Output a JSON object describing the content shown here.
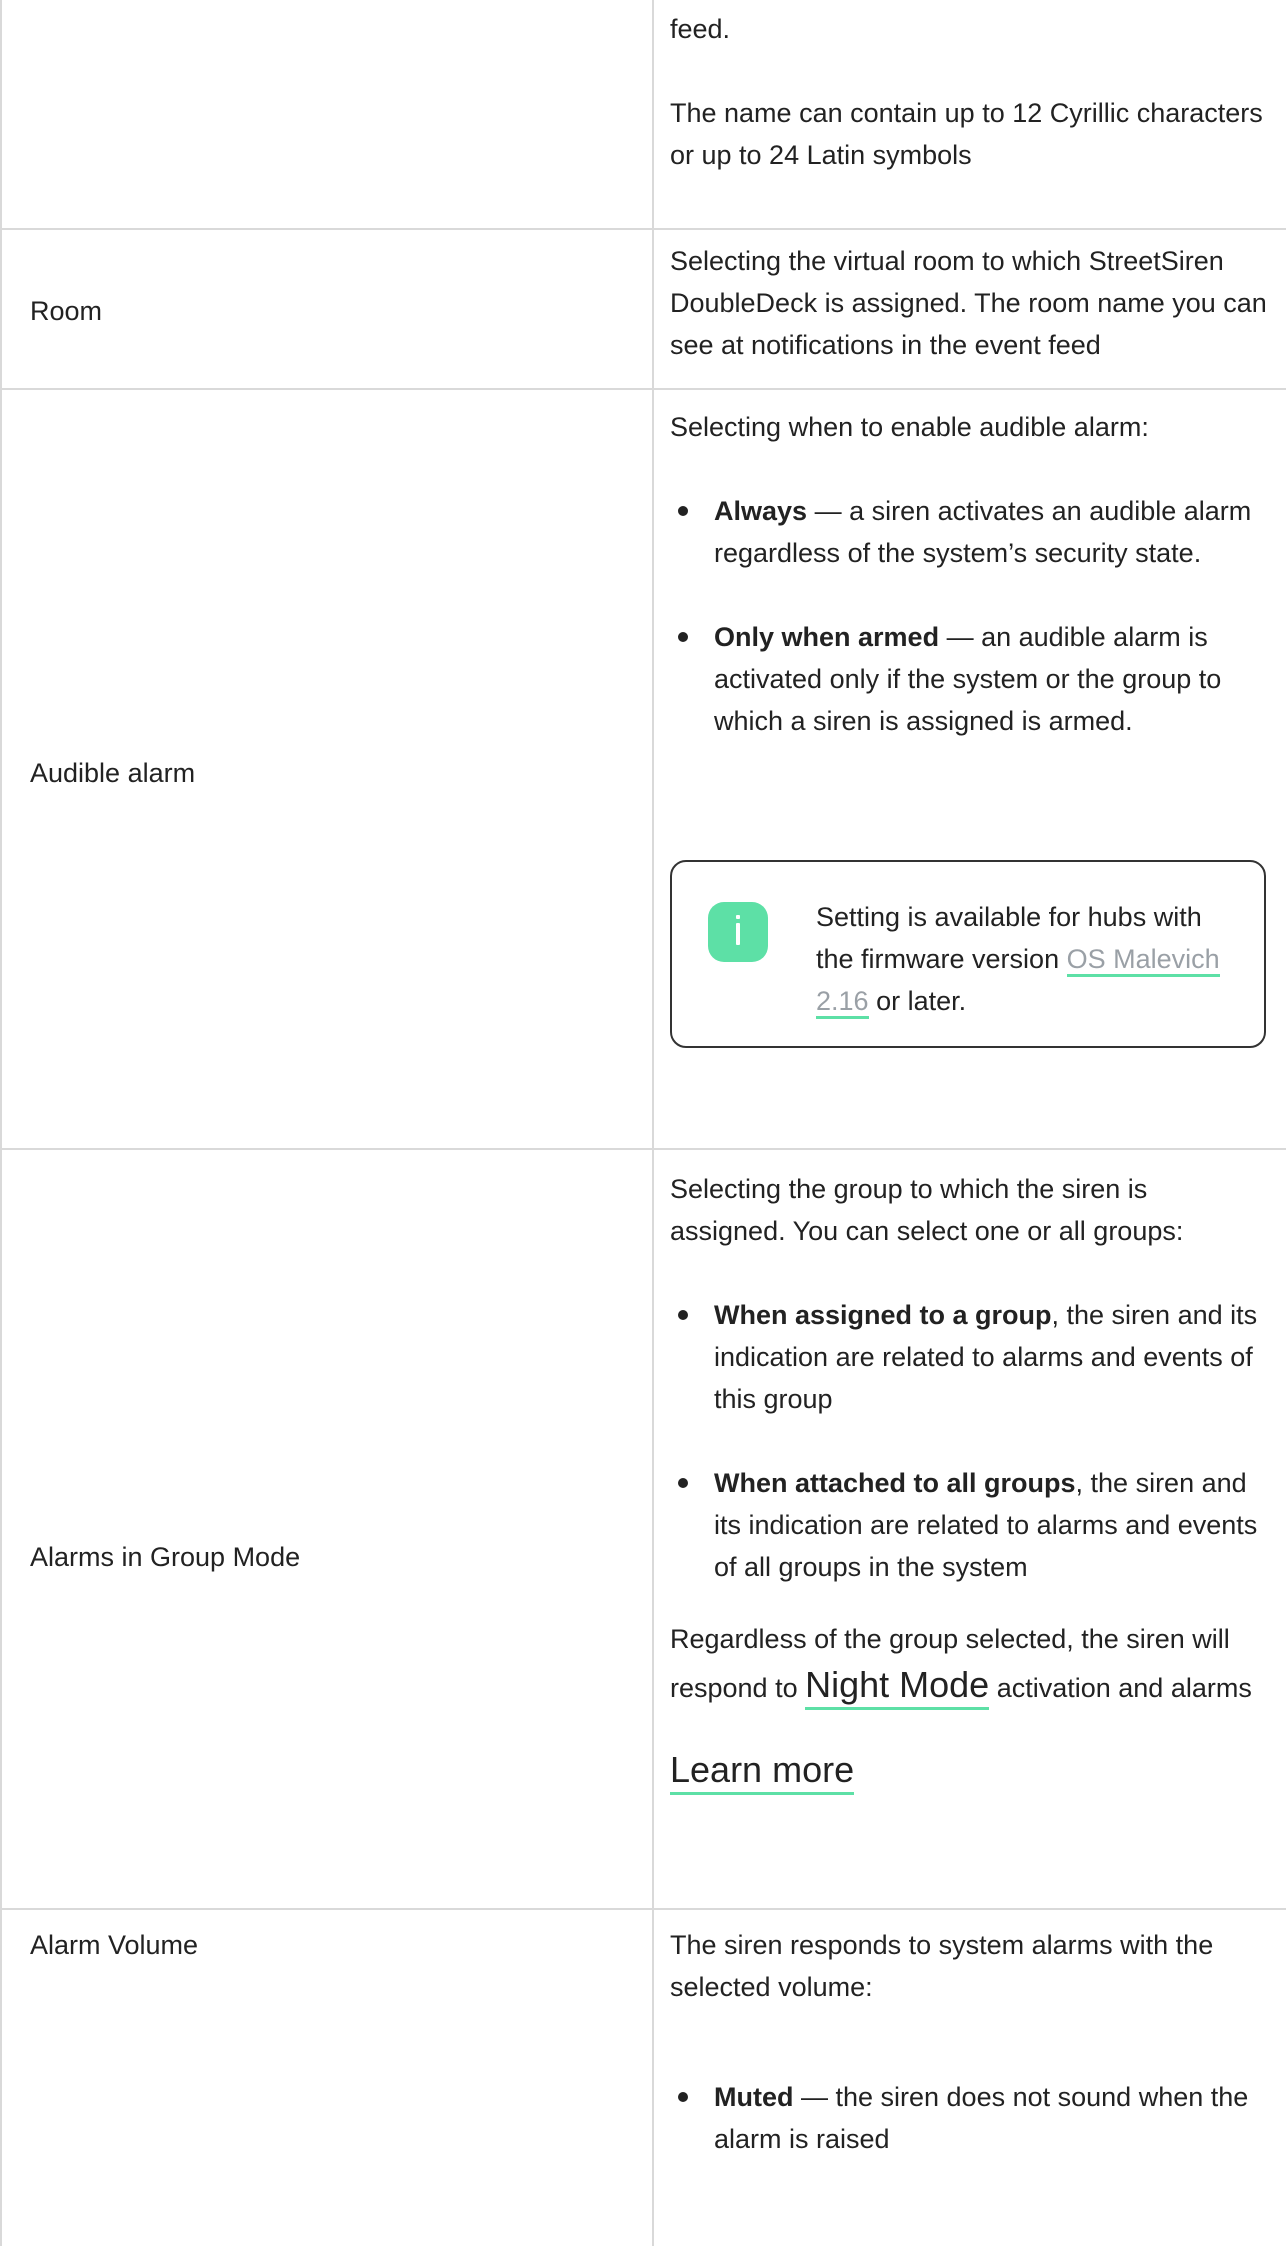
{
  "rows": [
    {
      "label": "",
      "desc": {
        "line_top": "feed.",
        "name_limit": "The name can contain up to 12 Cyrillic characters or up to 24 Latin symbols"
      }
    },
    {
      "label": "Room",
      "desc": "Selecting the virtual room to which StreetSiren DoubleDeck is assigned. The room name you can see at notifications in the event feed"
    },
    {
      "label": "Audible alarm",
      "intro": "Selecting when to enable audible alarm:",
      "bullets": [
        {
          "term": "Always",
          "text": " — a siren activates an audible alarm regardless of the system’s security state."
        },
        {
          "term": "Only when armed",
          "text": " — an audible alarm is activated only if the system or the group to which a siren is assigned is armed."
        }
      ],
      "info": {
        "before": "Setting is available for hubs with the firmware version ",
        "link": "OS Malevich 2.16",
        "after": " or later."
      }
    },
    {
      "label": "Alarms in Group Mode",
      "intro": "Selecting the group to which the siren is assigned. You can select one or all groups:",
      "bullets": [
        {
          "term": "When assigned to a group",
          "text": ", the siren and its indication are related to alarms and events of this group"
        },
        {
          "term": "When attached to all groups",
          "text": ", the siren and its indication are related to alarms and events of all groups in the system"
        }
      ],
      "note_before": "Regardless of the group selected, the siren will respond to ",
      "note_link": "Night Mode",
      "note_after": " activation and alarms",
      "learn_more": "Learn more"
    },
    {
      "label": "Alarm Volume",
      "intro": "The siren responds to system alarms with the selected volume:",
      "bullets": [
        {
          "term": "Muted",
          "text": " — the siren does not sound when the alarm is raised"
        }
      ]
    }
  ],
  "colors": {
    "accent": "#5de0a6",
    "border": "#d9d9d9",
    "link_gray": "#9aa0a6",
    "text": "#222222"
  },
  "icons": {
    "info": "info-icon"
  }
}
